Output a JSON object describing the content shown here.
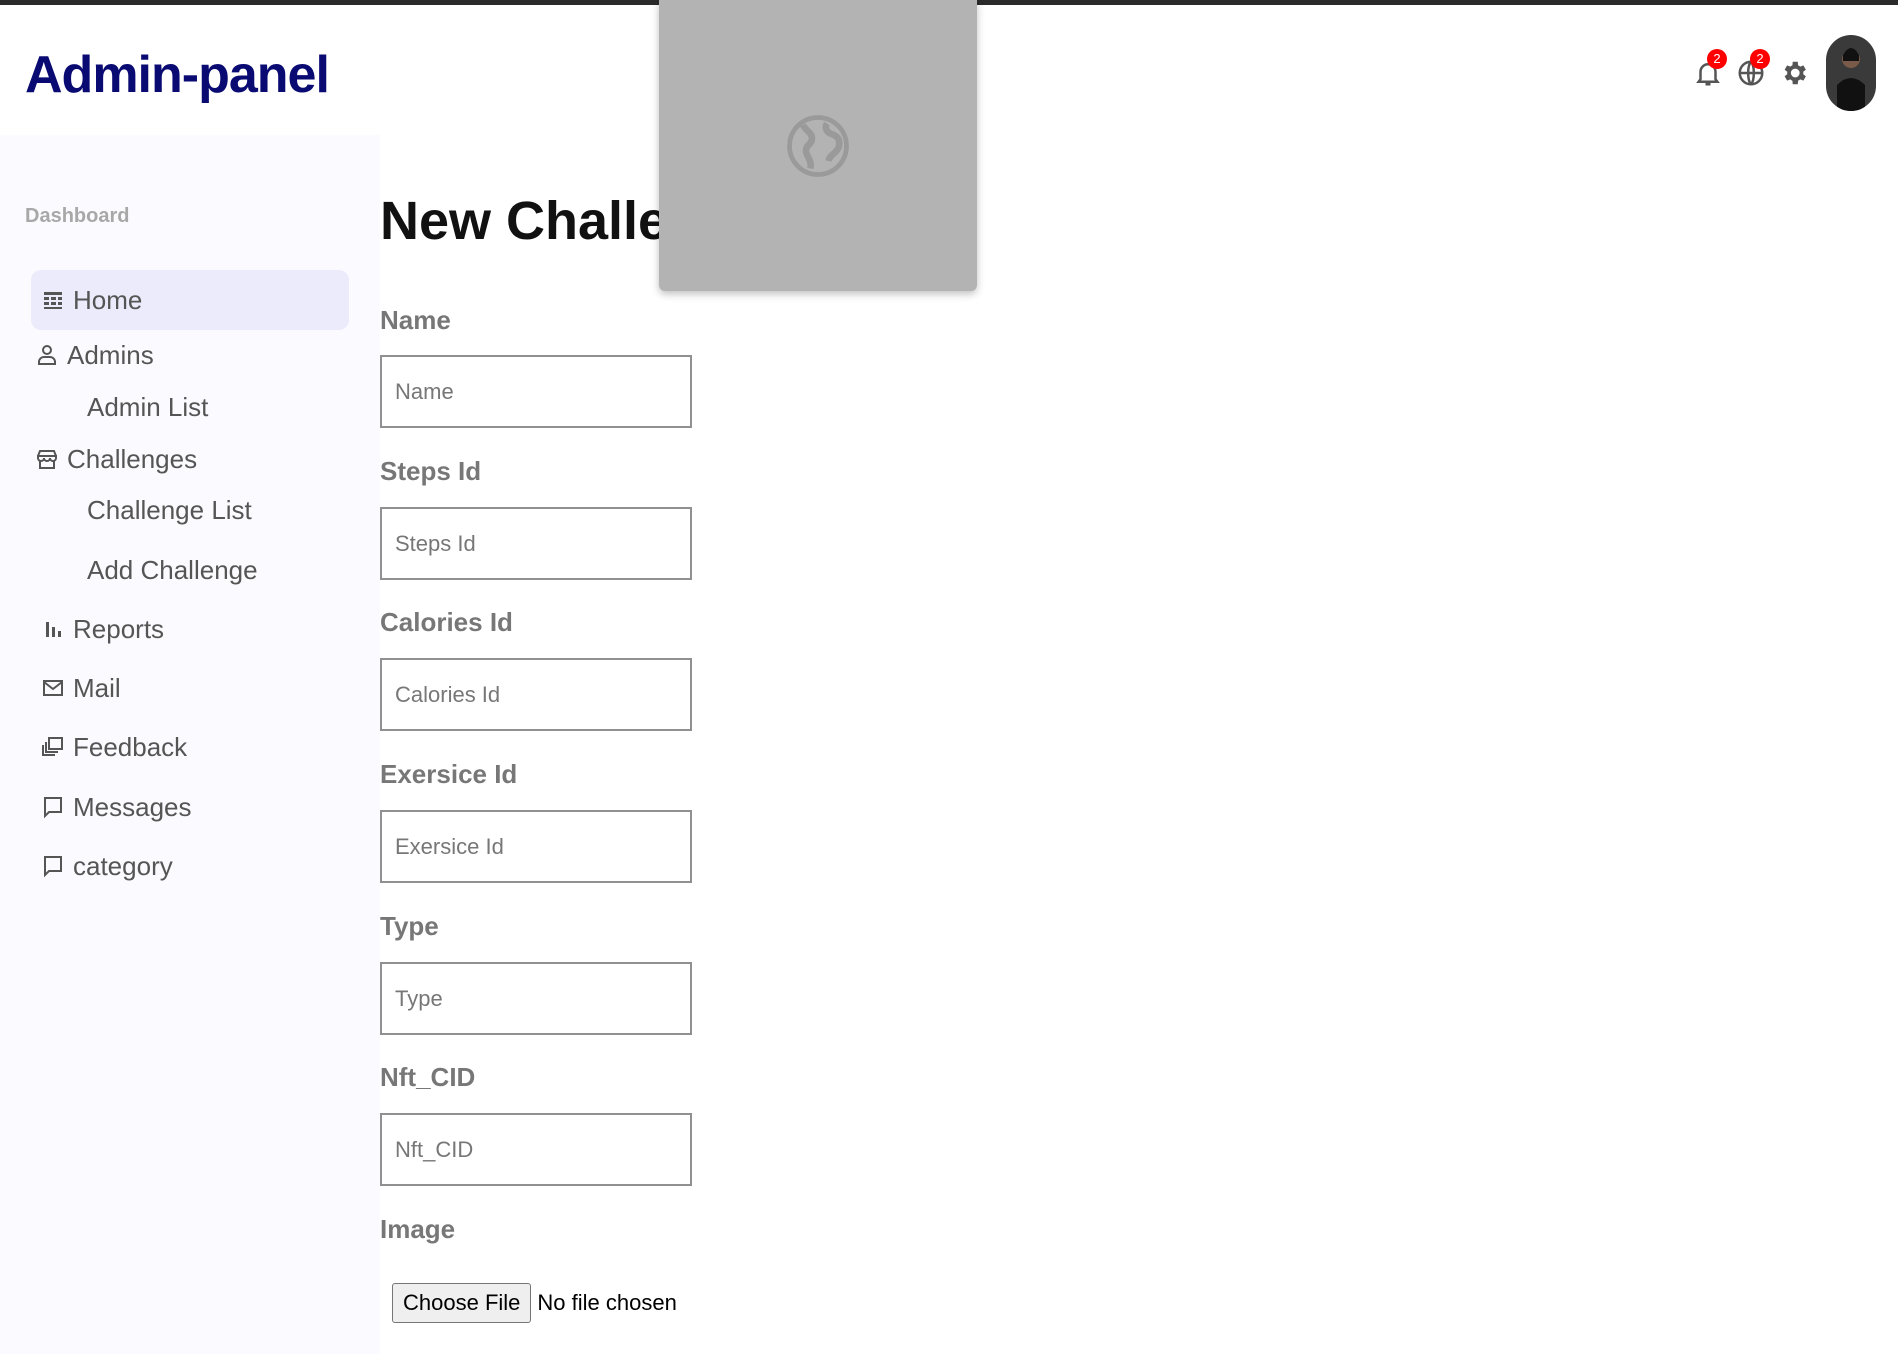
{
  "header": {
    "logo": "Admin-panel",
    "notifications_count": "2",
    "language_count": "2",
    "icons": [
      "bell-icon",
      "globe-icon",
      "gear-icon"
    ]
  },
  "sidebar": {
    "section_title": "Dashboard",
    "items": [
      {
        "label": "Home",
        "icon": "dashboard-icon",
        "active": true
      },
      {
        "label": "Admins",
        "icon": "person-icon"
      },
      {
        "label": "Admin List",
        "sub": true
      },
      {
        "label": "Challenges",
        "icon": "store-icon"
      },
      {
        "label": "Challenge List",
        "sub": true
      },
      {
        "label": "Add Challenge",
        "sub": true
      },
      {
        "label": "Reports",
        "icon": "bar-chart-icon"
      },
      {
        "label": "Mail",
        "icon": "mail-icon"
      },
      {
        "label": "Feedback",
        "icon": "feedback-icon"
      },
      {
        "label": "Messages",
        "icon": "chat-icon"
      },
      {
        "label": "category",
        "icon": "chat-icon"
      }
    ]
  },
  "main": {
    "title": "New Challenge",
    "fields": [
      {
        "label": "Name",
        "placeholder": "Name"
      },
      {
        "label": "Steps Id",
        "placeholder": "Steps Id"
      },
      {
        "label": "Calories Id",
        "placeholder": "Calories Id"
      },
      {
        "label": "Exersice Id",
        "placeholder": "Exersice Id"
      },
      {
        "label": "Type",
        "placeholder": "Type"
      },
      {
        "label": "Nft_CID",
        "placeholder": "Nft_CID"
      }
    ],
    "image_label": "Image",
    "file_button": "Choose File",
    "file_status": "No file chosen"
  },
  "colors": {
    "logo": "#0a0a73",
    "badge": "#ff0000",
    "active_nav_bg": "#ecebfb",
    "sidebar_bg": "#fbfbff"
  }
}
